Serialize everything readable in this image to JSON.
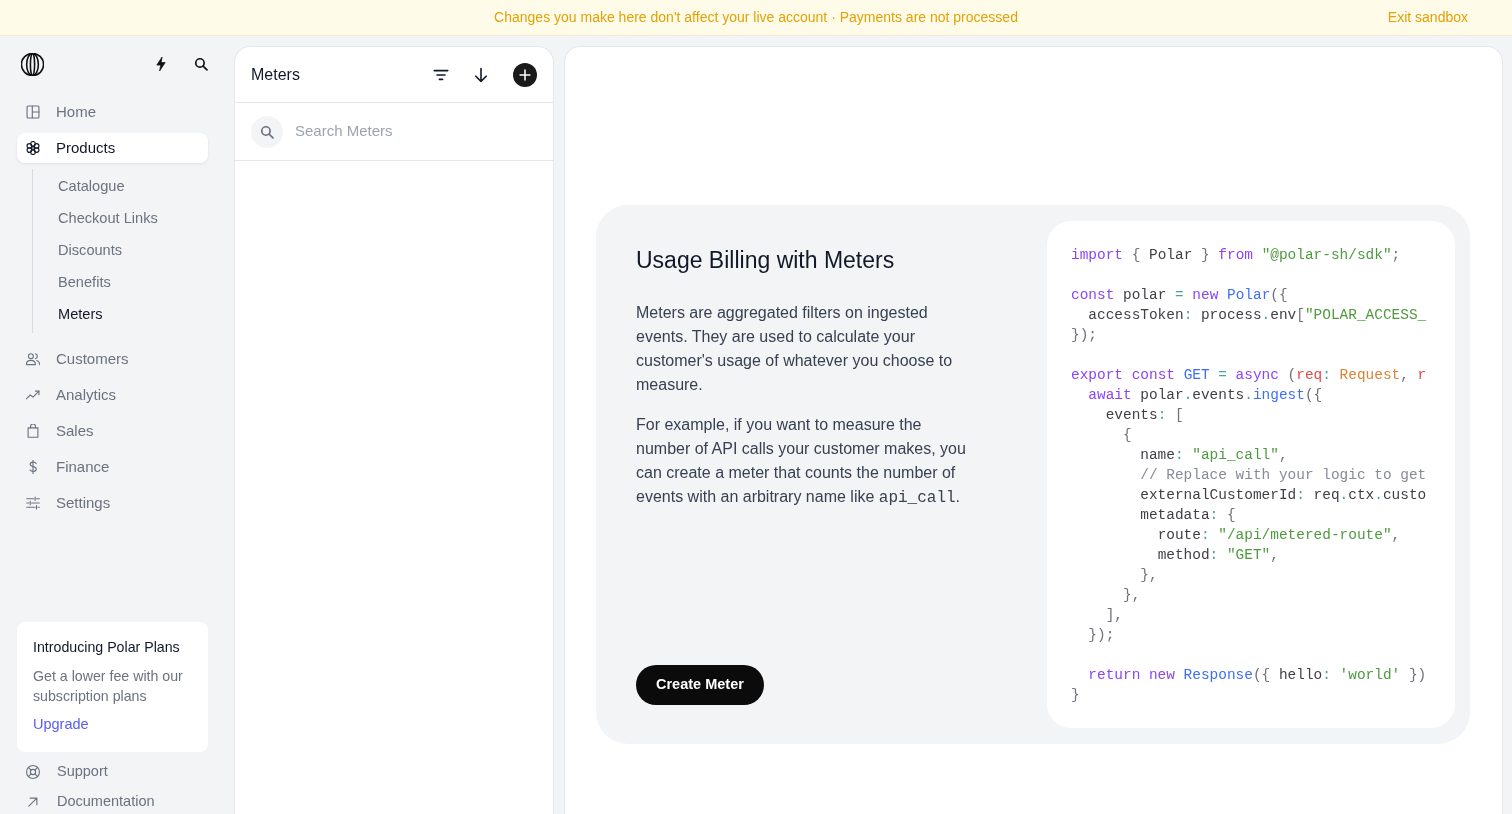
{
  "sandbox_banner": {
    "message": "Changes you make here don't affect your live account · Payments are not processed",
    "action": "Exit sandbox"
  },
  "sidebar": {
    "items": [
      {
        "label": "Home",
        "selected": false
      },
      {
        "label": "Products",
        "selected": true,
        "children": [
          {
            "label": "Catalogue",
            "selected": false
          },
          {
            "label": "Checkout Links",
            "selected": false
          },
          {
            "label": "Discounts",
            "selected": false
          },
          {
            "label": "Benefits",
            "selected": false
          },
          {
            "label": "Meters",
            "selected": true
          }
        ]
      },
      {
        "label": "Customers",
        "selected": false
      },
      {
        "label": "Analytics",
        "selected": false
      },
      {
        "label": "Sales",
        "selected": false
      },
      {
        "label": "Finance",
        "selected": false
      },
      {
        "label": "Settings",
        "selected": false
      }
    ],
    "promo": {
      "title": "Introducing Polar Plans",
      "text": "Get a lower fee with our subscription plans",
      "link": "Upgrade"
    },
    "footer_links": [
      {
        "label": "Support"
      },
      {
        "label": "Documentation"
      }
    ]
  },
  "list_panel": {
    "title": "Meters",
    "search": {
      "placeholder": "Search Meters"
    }
  },
  "detail_panel": {
    "title": "Usage Billing with Meters",
    "paragraphs": [
      [
        {
          "kind": "text",
          "text": "Meters are aggregated filters on ingested events. They are used to calculate your customer's usage of whatever you choose to measure."
        }
      ],
      [
        {
          "kind": "text",
          "text": "For example, if you want to measure the number of API calls your customer makes, you can create a meter that counts the number of events with an arbitrary name like "
        },
        {
          "kind": "code",
          "text": "api_call"
        },
        {
          "kind": "text",
          "text": "."
        }
      ]
    ],
    "button": "Create Meter",
    "code_sample": {
      "blocks": [
        [
          [
            {
              "kind": "keyword",
              "text": "import"
            },
            {
              "kind": "punct",
              "text": " { "
            },
            {
              "kind": "plain",
              "text": "Polar"
            },
            {
              "kind": "punct",
              "text": " } "
            },
            {
              "kind": "keyword",
              "text": "from"
            },
            {
              "kind": "string",
              "text": " \"@polar-sh/sdk\""
            },
            {
              "kind": "punct",
              "text": ";"
            }
          ]
        ],
        [
          [
            {
              "kind": "keyword",
              "text": "const"
            },
            {
              "kind": "plain",
              "text": " polar "
            },
            {
              "kind": "operator",
              "text": "="
            },
            {
              "kind": "keyword",
              "text": " new"
            },
            {
              "kind": "function",
              "text": " Polar"
            },
            {
              "kind": "punct",
              "text": "({"
            }
          ],
          [
            {
              "kind": "plain",
              "text": "  accessToken"
            },
            {
              "kind": "operator",
              "text": ":"
            },
            {
              "kind": "plain",
              "text": " process"
            },
            {
              "kind": "operator",
              "text": "."
            },
            {
              "kind": "plain",
              "text": "env"
            },
            {
              "kind": "punct",
              "text": "["
            },
            {
              "kind": "string",
              "text": "\"POLAR_ACCESS_"
            }
          ],
          [
            {
              "kind": "punct",
              "text": "});"
            }
          ]
        ],
        [
          [
            {
              "kind": "keyword",
              "text": "export const"
            },
            {
              "kind": "function",
              "text": " GET"
            },
            {
              "kind": "operator",
              "text": " ="
            },
            {
              "kind": "keyword",
              "text": " async"
            },
            {
              "kind": "punct",
              "text": " ("
            },
            {
              "kind": "param",
              "text": "req"
            },
            {
              "kind": "operator",
              "text": ":"
            },
            {
              "kind": "type",
              "text": " Request"
            },
            {
              "kind": "punct",
              "text": ", "
            },
            {
              "kind": "param",
              "text": "r"
            }
          ],
          [
            {
              "kind": "keyword",
              "text": "  await"
            },
            {
              "kind": "plain",
              "text": " polar"
            },
            {
              "kind": "operator",
              "text": "."
            },
            {
              "kind": "plain",
              "text": "events"
            },
            {
              "kind": "operator",
              "text": "."
            },
            {
              "kind": "function",
              "text": "ingest"
            },
            {
              "kind": "punct",
              "text": "({"
            }
          ],
          [
            {
              "kind": "plain",
              "text": "    events"
            },
            {
              "kind": "operator",
              "text": ":"
            },
            {
              "kind": "punct",
              "text": " ["
            }
          ],
          [
            {
              "kind": "punct",
              "text": "      {"
            }
          ],
          [
            {
              "kind": "plain",
              "text": "        name"
            },
            {
              "kind": "operator",
              "text": ":"
            },
            {
              "kind": "string",
              "text": " \"api_call\""
            },
            {
              "kind": "punct",
              "text": ","
            }
          ],
          [
            {
              "kind": "comment",
              "text": "        // Replace with your logic to get"
            }
          ],
          [
            {
              "kind": "plain",
              "text": "        externalCustomerId"
            },
            {
              "kind": "operator",
              "text": ":"
            },
            {
              "kind": "plain",
              "text": " req"
            },
            {
              "kind": "operator",
              "text": "."
            },
            {
              "kind": "plain",
              "text": "ctx"
            },
            {
              "kind": "operator",
              "text": "."
            },
            {
              "kind": "plain",
              "text": "custo"
            }
          ],
          [
            {
              "kind": "plain",
              "text": "        metadata"
            },
            {
              "kind": "operator",
              "text": ":"
            },
            {
              "kind": "punct",
              "text": " {"
            }
          ],
          [
            {
              "kind": "plain",
              "text": "          route"
            },
            {
              "kind": "operator",
              "text": ":"
            },
            {
              "kind": "string",
              "text": " \"/api/metered-route\""
            },
            {
              "kind": "punct",
              "text": ","
            }
          ],
          [
            {
              "kind": "plain",
              "text": "          method"
            },
            {
              "kind": "operator",
              "text": ":"
            },
            {
              "kind": "string",
              "text": " \"GET\""
            },
            {
              "kind": "punct",
              "text": ","
            }
          ],
          [
            {
              "kind": "punct",
              "text": "        },"
            }
          ],
          [
            {
              "kind": "punct",
              "text": "      },"
            }
          ],
          [
            {
              "kind": "punct",
              "text": "    ],"
            }
          ],
          [
            {
              "kind": "punct",
              "text": "  });"
            }
          ]
        ],
        [
          [
            {
              "kind": "keyword",
              "text": "  return new"
            },
            {
              "kind": "function",
              "text": " Response"
            },
            {
              "kind": "punct",
              "text": "({ "
            },
            {
              "kind": "plain",
              "text": "hello"
            },
            {
              "kind": "operator",
              "text": ":"
            },
            {
              "kind": "string",
              "text": " 'world'"
            },
            {
              "kind": "punct",
              "text": " })"
            }
          ],
          [
            {
              "kind": "punct",
              "text": "}"
            }
          ]
        ]
      ]
    }
  }
}
